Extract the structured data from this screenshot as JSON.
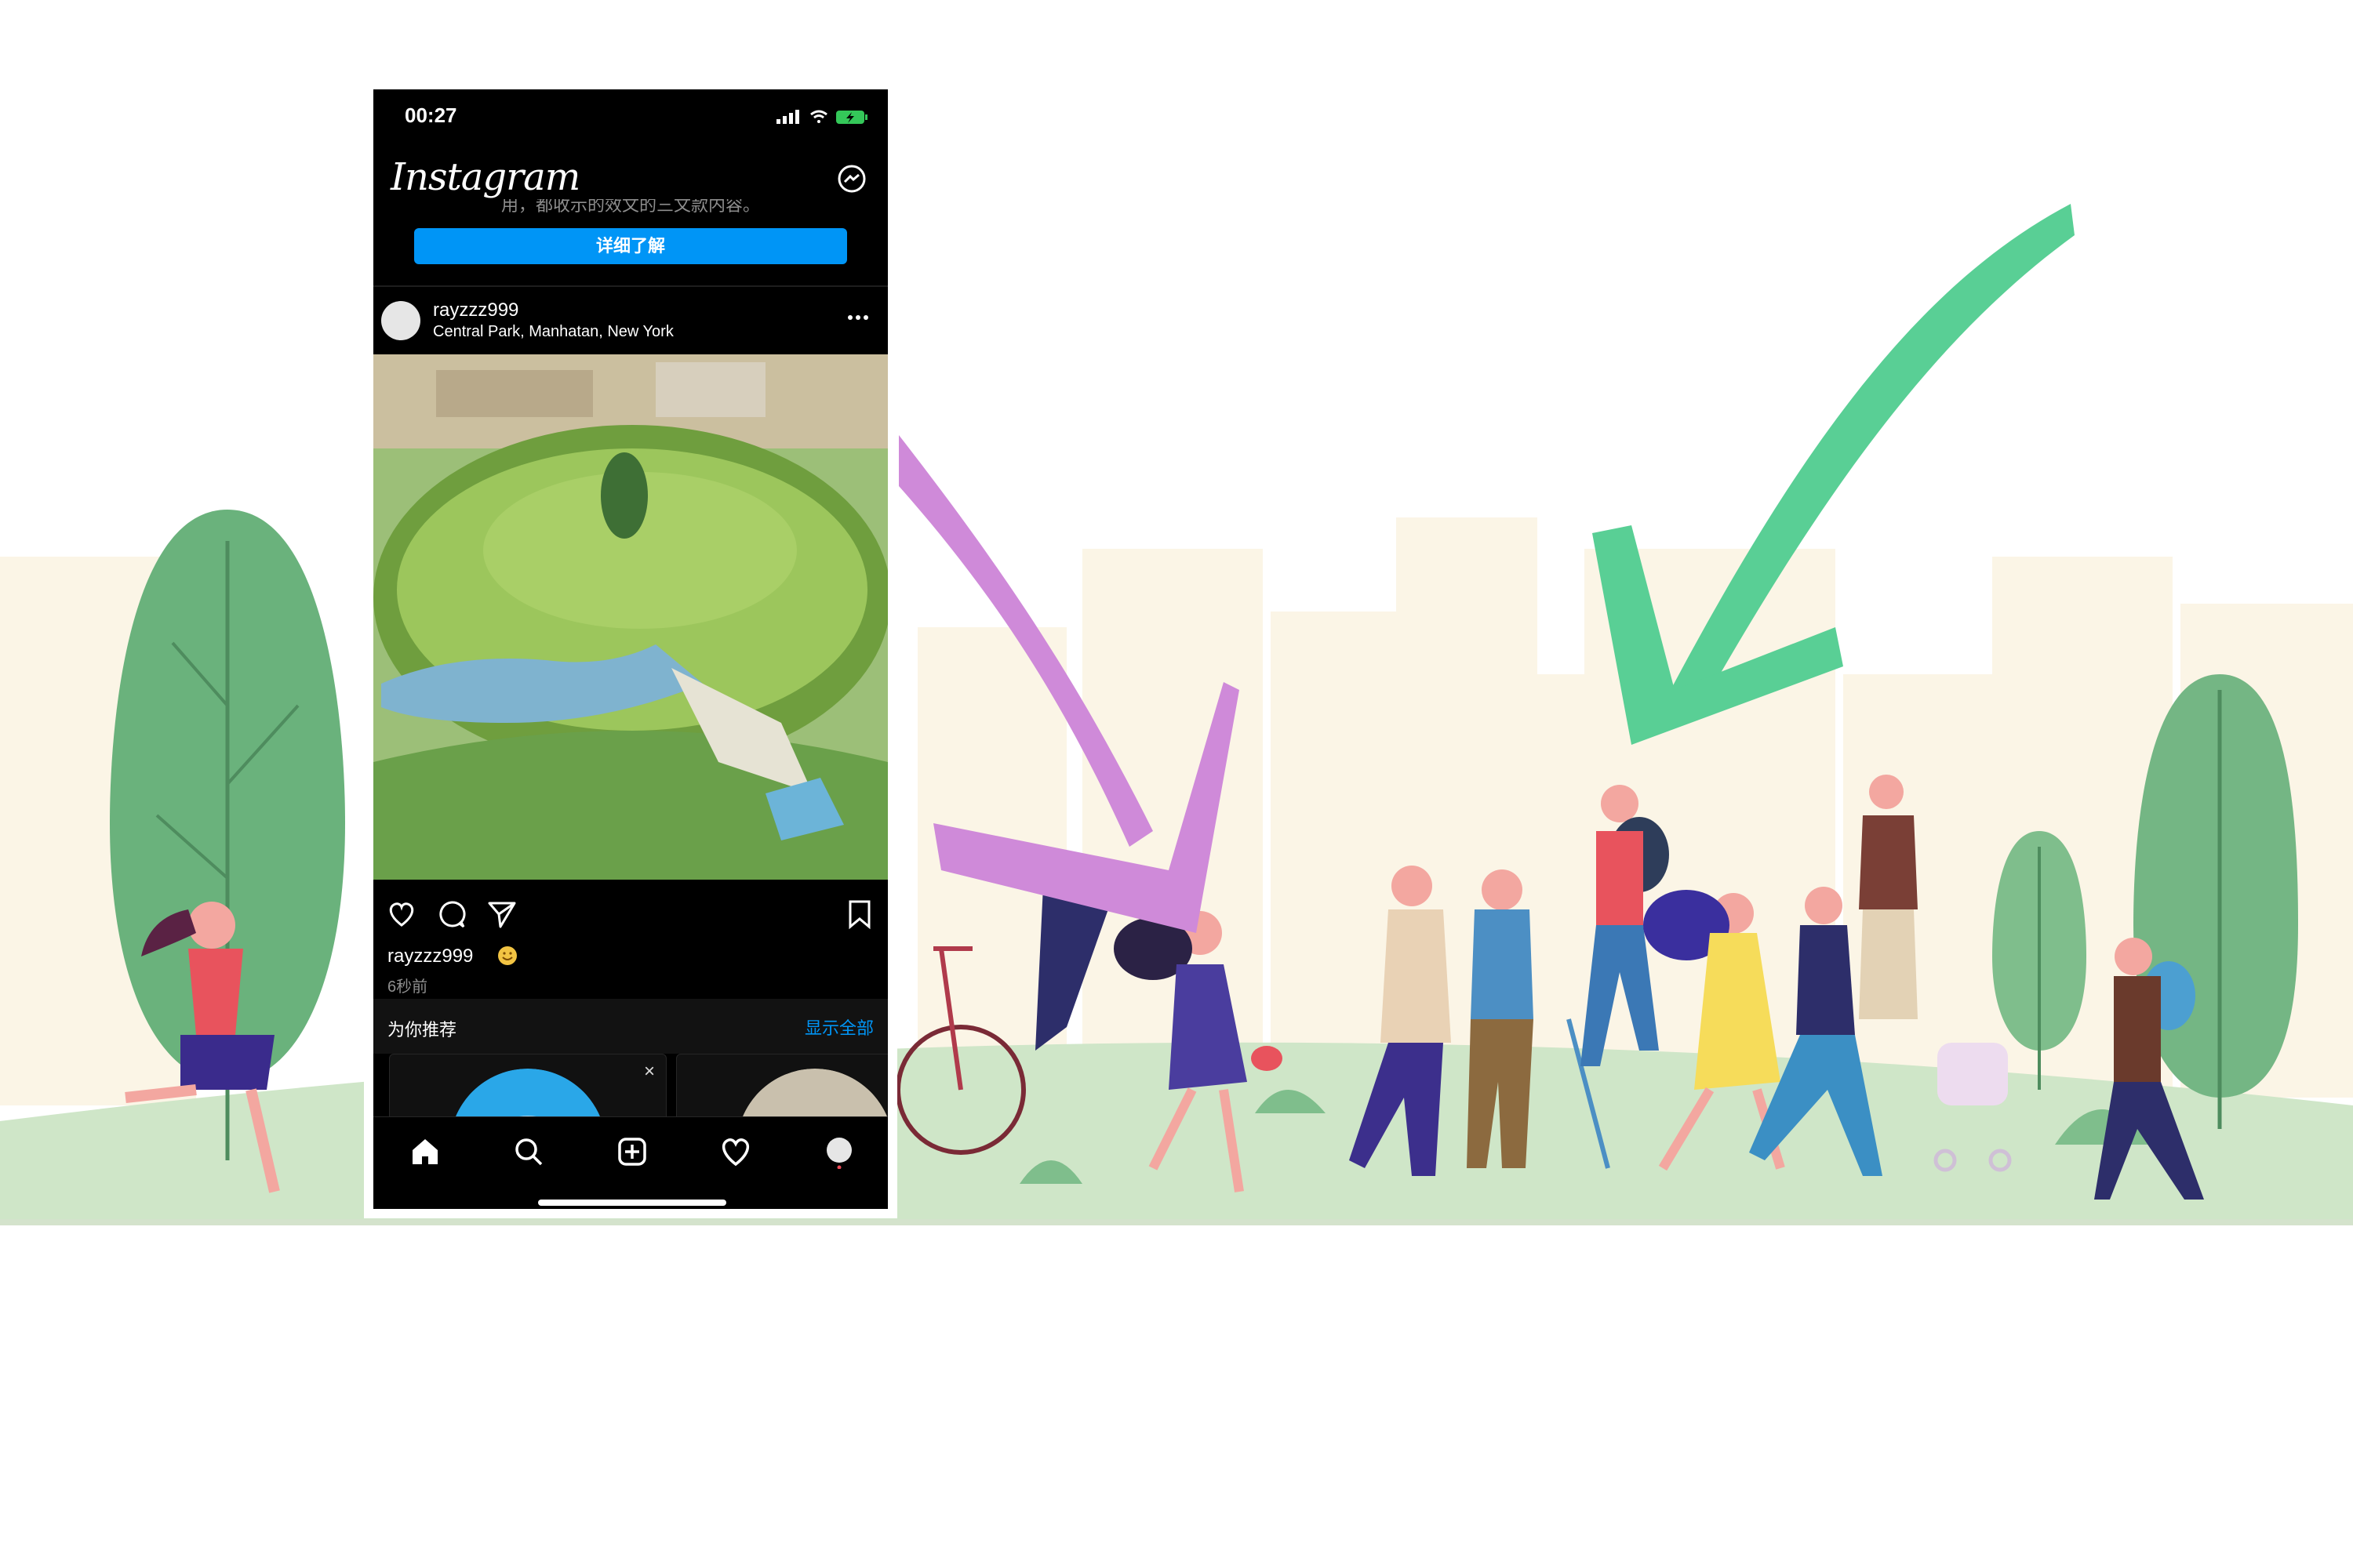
{
  "phone": {
    "status_bar": {
      "time": "00:27"
    },
    "header": {
      "logo": "Instagram",
      "messenger_icon": "messenger-icon"
    },
    "banner": {
      "partial_text": "用，都收示的效文的三文款内容。",
      "button_label": "详细了解"
    },
    "post": {
      "username": "rayzzz999",
      "location": "Central Park, Manhatan, New York",
      "caption_user": "rayzzz999",
      "time_ago": "6秒前"
    },
    "suggestions": {
      "title": "为你推荐",
      "show_all": "显示全部"
    },
    "tabs": [
      "home-icon",
      "search-icon",
      "new-post-icon",
      "activity-heart-icon",
      "profile-icon"
    ]
  },
  "colors": {
    "accent_blue": "#0095f6",
    "purple_arrow": "#cf8ad9",
    "green_arrow": "#59cf95",
    "ground": "#cfe6c8",
    "skyline": "#fbf5e6"
  }
}
